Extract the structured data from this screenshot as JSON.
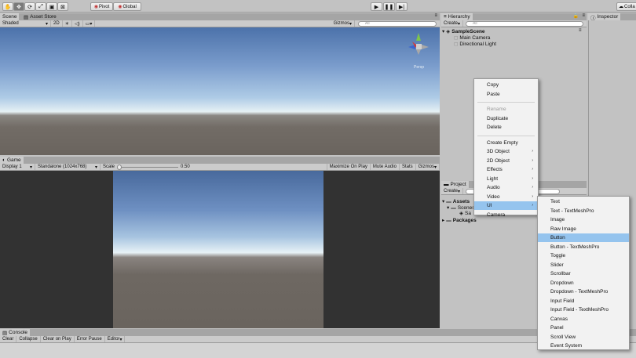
{
  "toolbar": {
    "tools": [
      "hand-tool",
      "move-tool",
      "rotate-tool",
      "scale-tool",
      "rect-tool",
      "transform-tool"
    ],
    "pivot_label": "Pivot",
    "global_label": "Global",
    "collab_label": "Colla"
  },
  "scene_tabs": {
    "scene": "Scene",
    "asset_store": "Asset Store"
  },
  "scene_toolbar": {
    "shading": "Shaded",
    "mode_2d": "2D",
    "gizmos": "Gizmos",
    "search_placeholder": "All"
  },
  "gizmo_label": "Persp",
  "game": {
    "tab": "Game",
    "display": "Display 1",
    "resolution": "Standalone (1024x768)",
    "scale_label": "Scale",
    "scale_value": "0.50",
    "maximize": "Maximize On Play",
    "mute": "Mute Audio",
    "stats": "Stats",
    "gizmos": "Gizmos"
  },
  "hierarchy": {
    "tab": "Hierarchy",
    "create": "Create",
    "search_placeholder": "All",
    "scene": "SampleScene",
    "items": [
      "Main Camera",
      "Directional Light"
    ]
  },
  "inspector": {
    "tab": "Inspector"
  },
  "project": {
    "tab": "Project",
    "create": "Create",
    "items": {
      "assets": "Assets",
      "scenes": "Scenes",
      "sample": "Sa",
      "packages": "Packages"
    }
  },
  "console": {
    "tab": "Console",
    "buttons": [
      "Clear",
      "Collapse",
      "Clear on Play",
      "Error Pause",
      "Editor"
    ]
  },
  "context_menu": [
    {
      "label": "Copy"
    },
    {
      "label": "Paste"
    },
    {
      "sep": true
    },
    {
      "label": "Rename",
      "disabled": true
    },
    {
      "label": "Duplicate"
    },
    {
      "label": "Delete"
    },
    {
      "sep": true
    },
    {
      "label": "Create Empty"
    },
    {
      "label": "3D Object",
      "sub": true
    },
    {
      "label": "2D Object",
      "sub": true
    },
    {
      "label": "Effects",
      "sub": true
    },
    {
      "label": "Light",
      "sub": true
    },
    {
      "label": "Audio",
      "sub": true
    },
    {
      "label": "Video",
      "sub": true
    },
    {
      "label": "UI",
      "sub": true,
      "highlight": true
    },
    {
      "label": "Camera"
    }
  ],
  "ui_submenu": [
    {
      "label": "Text"
    },
    {
      "label": "Text - TextMeshPro"
    },
    {
      "label": "Image"
    },
    {
      "label": "Raw Image"
    },
    {
      "label": "Button",
      "highlight": true
    },
    {
      "label": "Button - TextMeshPro"
    },
    {
      "label": "Toggle"
    },
    {
      "label": "Slider"
    },
    {
      "label": "Scrollbar"
    },
    {
      "label": "Dropdown"
    },
    {
      "label": "Dropdown - TextMeshPro"
    },
    {
      "label": "Input Field"
    },
    {
      "label": "Input Field - TextMeshPro"
    },
    {
      "label": "Canvas"
    },
    {
      "label": "Panel"
    },
    {
      "label": "Scroll View"
    },
    {
      "label": "Event System"
    }
  ],
  "colors": {
    "highlight": "#95c4ee",
    "sky_top": "#4f77ad",
    "ground": "#6e6862",
    "panel": "#c2c2c2"
  }
}
